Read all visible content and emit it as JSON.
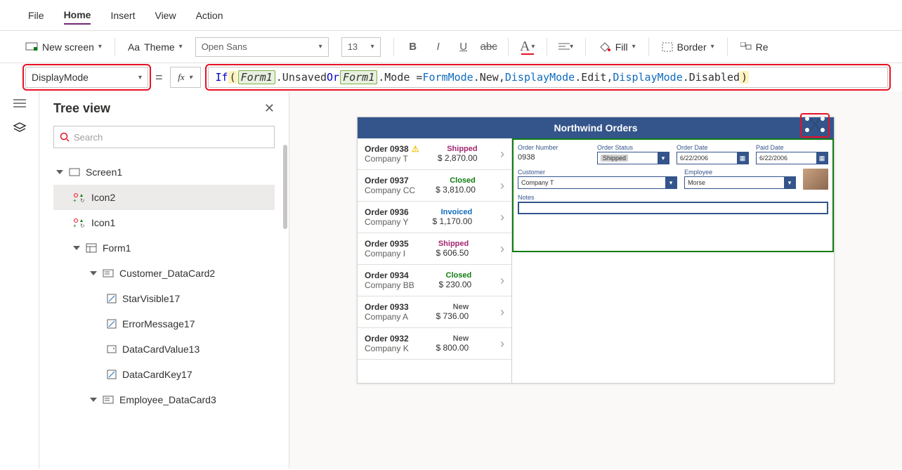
{
  "menu": {
    "file": "File",
    "home": "Home",
    "insert": "Insert",
    "view": "View",
    "action": "Action"
  },
  "toolbar": {
    "newscreen": "New screen",
    "theme": "Theme",
    "font": "Open Sans",
    "size": "13",
    "fill": "Fill",
    "border": "Border",
    "align": "Re"
  },
  "property": {
    "selected": "DisplayMode"
  },
  "formula": {
    "if": "If",
    "p1": "(",
    "sp": " ",
    "ref1": "Form1",
    "dot1": ".Unsaved ",
    "or": "Or",
    "ref2": "Form1",
    "dot2": ".Mode = ",
    "fm": "FormMode",
    "dot3": ".New, ",
    "dm1": "DisplayMode",
    "dot4": ".Edit, ",
    "dm2": "DisplayMode",
    "dot5": ".Disabled ",
    "p2": ")"
  },
  "tree": {
    "title": "Tree view",
    "search_ph": "Search",
    "items": [
      "Screen1",
      "Icon2",
      "Icon1",
      "Form1",
      "Customer_DataCard2",
      "StarVisible17",
      "ErrorMessage17",
      "DataCardValue13",
      "DataCardKey17",
      "Employee_DataCard3"
    ]
  },
  "app": {
    "title": "Northwind Orders",
    "orders": [
      {
        "id": "Order 0938",
        "company": "Company T",
        "status": "Shipped",
        "cls": "st-shipped",
        "amount": "$ 2,870.00",
        "warn": true
      },
      {
        "id": "Order 0937",
        "company": "Company CC",
        "status": "Closed",
        "cls": "st-closed",
        "amount": "$ 3,810.00"
      },
      {
        "id": "Order 0936",
        "company": "Company Y",
        "status": "Invoiced",
        "cls": "st-invoiced",
        "amount": "$ 1,170.00"
      },
      {
        "id": "Order 0935",
        "company": "Company I",
        "status": "Shipped",
        "cls": "st-shipped",
        "amount": "$ 606.50"
      },
      {
        "id": "Order 0934",
        "company": "Company BB",
        "status": "Closed",
        "cls": "st-closed",
        "amount": "$ 230.00"
      },
      {
        "id": "Order 0933",
        "company": "Company A",
        "status": "New",
        "cls": "st-new",
        "amount": "$ 736.00"
      },
      {
        "id": "Order 0932",
        "company": "Company K",
        "status": "New",
        "cls": "st-new",
        "amount": "$ 800.00"
      }
    ],
    "form": {
      "ordernum_l": "Order Number",
      "ordernum_v": "0938",
      "orderstatus_l": "Order Status",
      "orderstatus_v": "Shipped",
      "orderdate_l": "Order Date",
      "orderdate_v": "6/22/2006",
      "paiddate_l": "Paid Date",
      "paiddate_v": "6/22/2006",
      "customer_l": "Customer",
      "customer_v": "Company T",
      "employee_l": "Employee",
      "employee_v": "Morse",
      "notes_l": "Notes"
    }
  }
}
